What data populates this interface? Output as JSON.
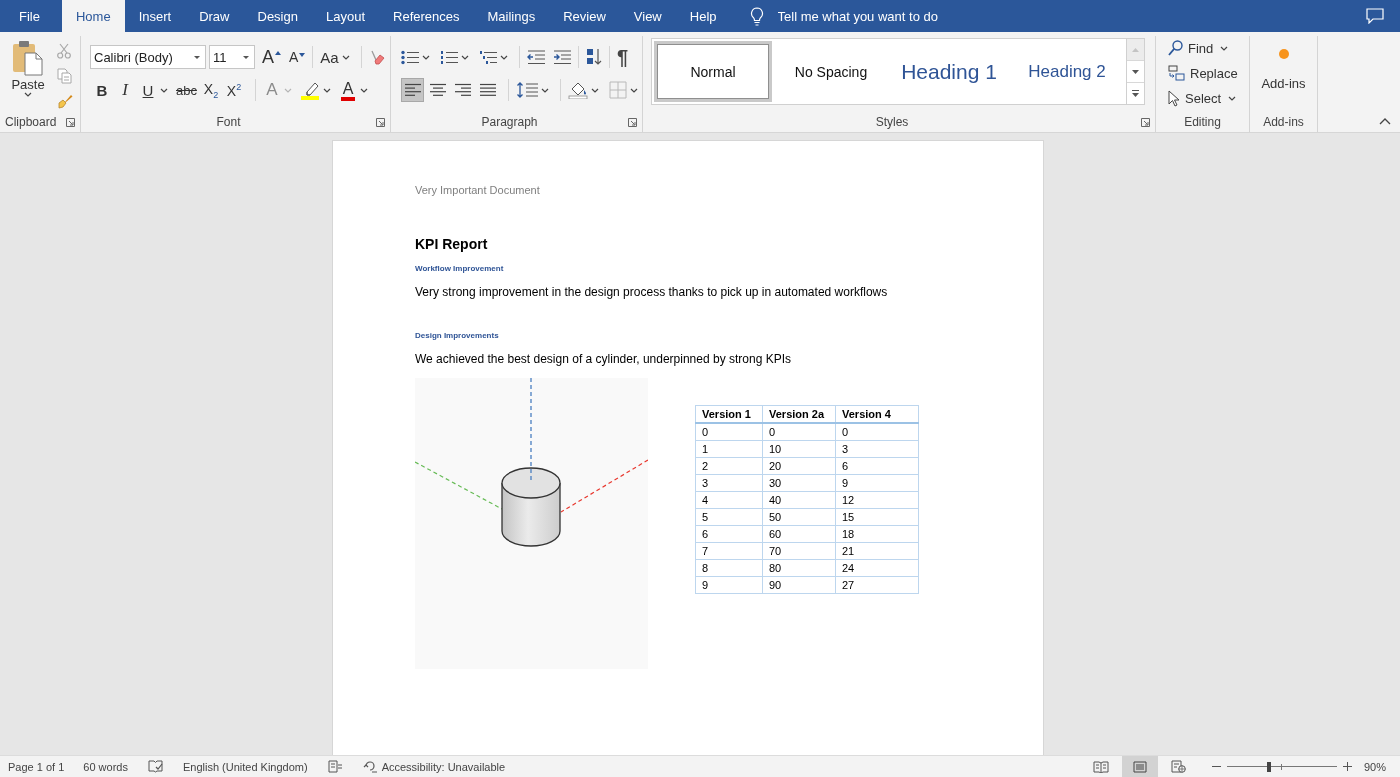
{
  "tabs": [
    {
      "label": "File",
      "selected": false
    },
    {
      "label": "Home",
      "selected": true
    },
    {
      "label": "Insert",
      "selected": false
    },
    {
      "label": "Draw",
      "selected": false
    },
    {
      "label": "Design",
      "selected": false
    },
    {
      "label": "Layout",
      "selected": false
    },
    {
      "label": "References",
      "selected": false
    },
    {
      "label": "Mailings",
      "selected": false
    },
    {
      "label": "Review",
      "selected": false
    },
    {
      "label": "View",
      "selected": false
    },
    {
      "label": "Help",
      "selected": false
    }
  ],
  "tell_me": {
    "placeholder": "Tell me what you want to do"
  },
  "clipboard": {
    "paste": "Paste",
    "cut": {
      "disabled": true
    },
    "copy": {
      "disabled": true
    },
    "group_label": "Clipboard"
  },
  "font": {
    "font_name": "Calibri (Body)",
    "font_size": "11",
    "grow": "A",
    "shrink": "A",
    "change_case": "Aa",
    "bold": "B",
    "italic": "I",
    "underline": "U",
    "strikethrough": "abc",
    "subscript": "X$_{2}$",
    "superscript": "X$^{2}$",
    "text_effects": {
      "label": "A",
      "disabled": true
    },
    "font_color": "A",
    "group_label": "Font"
  },
  "paragraph": {
    "show_marks": "¶",
    "alignments": [
      {
        "kind": "left",
        "selected": true
      },
      {
        "kind": "center",
        "selected": false
      },
      {
        "kind": "right",
        "selected": false
      },
      {
        "kind": "justify",
        "selected": false
      }
    ],
    "group_label": "Paragraph"
  },
  "styles": {
    "items": [
      {
        "label": "Normal",
        "kind": "normal",
        "selected": true
      },
      {
        "label": "No Spacing",
        "kind": "no_spacing",
        "selected": false
      },
      {
        "label": "Heading 1",
        "kind": "heading1",
        "selected": false
      },
      {
        "label": "Heading 2",
        "kind": "heading2",
        "selected": false
      }
    ],
    "scroll_up": {
      "disabled": true
    },
    "group_label": "Styles"
  },
  "editing": {
    "find": "Find",
    "replace": "Replace",
    "select": "Select",
    "group_label": "Editing"
  },
  "add_ins": {
    "button": "Add-ins",
    "group_label": "Add-ins"
  },
  "document": {
    "header": "Very Important Document",
    "title": "KPI Report",
    "sections": [
      {
        "heading": "Workflow Improvement",
        "body": "Very strong improvement in the design process thanks to pick up in automated workflows"
      },
      {
        "heading": "Design Improvements",
        "body": "We achieved the best design of a cylinder, underpinned by strong KPIs"
      }
    ],
    "table": {
      "columns": [
        "Version 1",
        "Version 2a",
        "Version 4"
      ],
      "rows": [
        [
          "0",
          "0",
          "0"
        ],
        [
          "1",
          "10",
          "3"
        ],
        [
          "2",
          "20",
          "6"
        ],
        [
          "3",
          "30",
          "9"
        ],
        [
          "4",
          "40",
          "12"
        ],
        [
          "5",
          "50",
          "15"
        ],
        [
          "6",
          "60",
          "18"
        ],
        [
          "7",
          "70",
          "21"
        ],
        [
          "8",
          "80",
          "24"
        ],
        [
          "9",
          "90",
          "27"
        ]
      ]
    }
  },
  "status_bar": {
    "page": "Page 1 of 1",
    "words": "60 words",
    "language": "English (United Kingdom)",
    "accessibility": "Accessibility: Unavailable",
    "views": [
      {
        "kind": "read_mode",
        "selected": false
      },
      {
        "kind": "print_layout",
        "selected": true
      },
      {
        "kind": "web_layout",
        "selected": false
      }
    ],
    "zoom": {
      "level": 0.38,
      "reading": "90%"
    }
  }
}
